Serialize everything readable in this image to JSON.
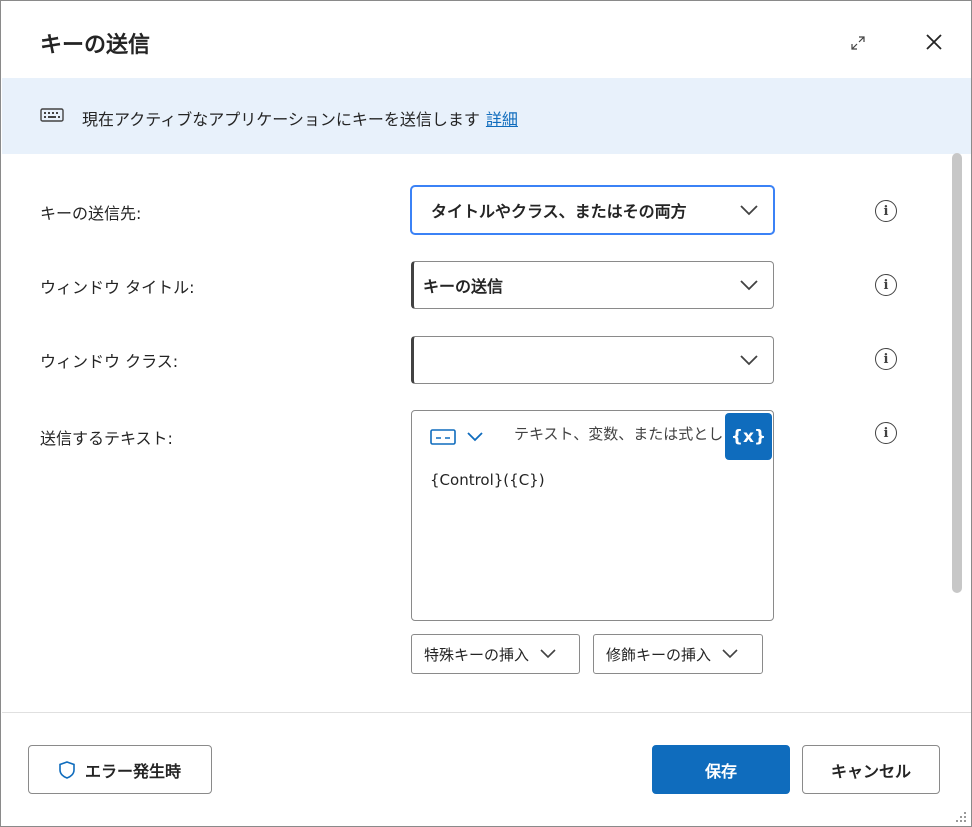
{
  "dialog": {
    "title": "キーの送信",
    "expand_icon": "expand-icon",
    "close_icon": "close-icon"
  },
  "banner": {
    "icon": "keyboard-icon",
    "text": "現在アクティブなアプリケーションにキーを送信します",
    "link": "詳細"
  },
  "form": {
    "send_to": {
      "label": "キーの送信先:",
      "value": "タイトルやクラス、またはその両方"
    },
    "window_title": {
      "label": "ウィンドウ タイトル:",
      "value": "キーの送信"
    },
    "window_class": {
      "label": "ウィンドウ クラス:",
      "value": ""
    },
    "text_to_send": {
      "label": "送信するテキスト:",
      "placeholder": "テキスト、変数、または式とし",
      "variable_button": "{x}",
      "value": "{Control}({C})"
    },
    "insert_special_key": "特殊キーの挿入",
    "insert_modifier_key": "修飾キーの挿入"
  },
  "footer": {
    "on_error": "エラー発生時",
    "save": "保存",
    "cancel": "キャンセル"
  },
  "colors": {
    "accent": "#0f6cbd",
    "banner_bg": "#e8f1fb",
    "focus_border": "#3b82f6"
  }
}
